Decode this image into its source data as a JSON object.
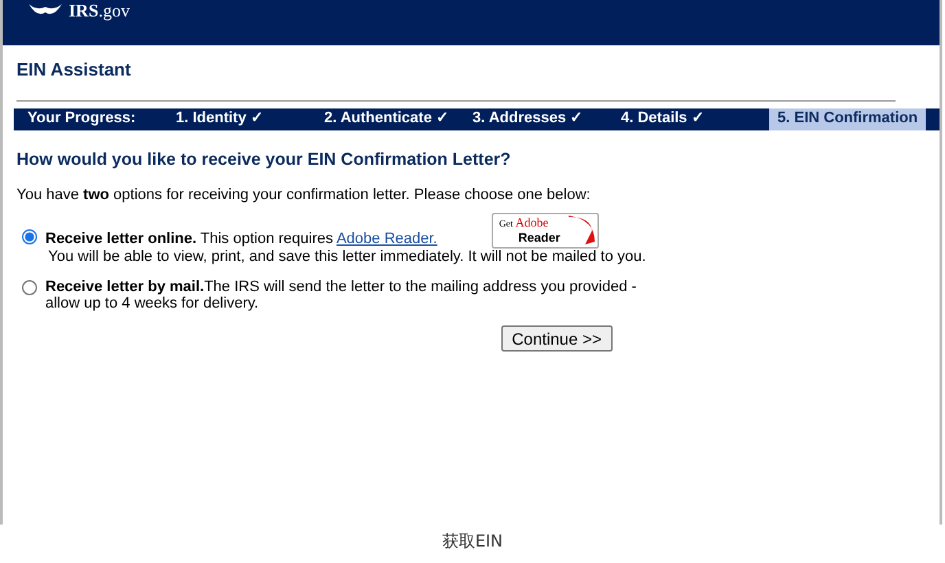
{
  "header": {
    "logo_text": "IRS",
    "logo_suffix": ".gov"
  },
  "title": "EIN Assistant",
  "progress": {
    "label": "Your Progress:",
    "steps": [
      {
        "label": "1. Identity ✓",
        "selected": false
      },
      {
        "label": "2. Authenticate ✓",
        "selected": false
      },
      {
        "label": "3. Addresses ✓",
        "selected": false
      },
      {
        "label": "4. Details ✓",
        "selected": false
      },
      {
        "label": "5. EIN Confirmation",
        "selected": true
      }
    ]
  },
  "question": "How would you like to receive your EIN Confirmation Letter?",
  "intro": "You have **two** options for receiving your confirmation letter. Please choose one below:",
  "options": [
    {
      "selected": true,
      "lead": "Receive letter online.",
      "text": "This option requires",
      "link": "Adobe Reader.",
      "detail": "You will be able to view, print, and save this letter immediately. It will not be mailed to you.",
      "badge": {
        "small": "Get",
        "brand": "Adobe",
        "product": "Reader"
      }
    },
    {
      "selected": false,
      "lead": "Receive letter by mail.",
      "text": "The IRS will send the letter to the mailing address you provided - allow up to 4 weeks for delivery."
    }
  ],
  "continue_button": "Continue >>",
  "caption": "获取EIN"
}
